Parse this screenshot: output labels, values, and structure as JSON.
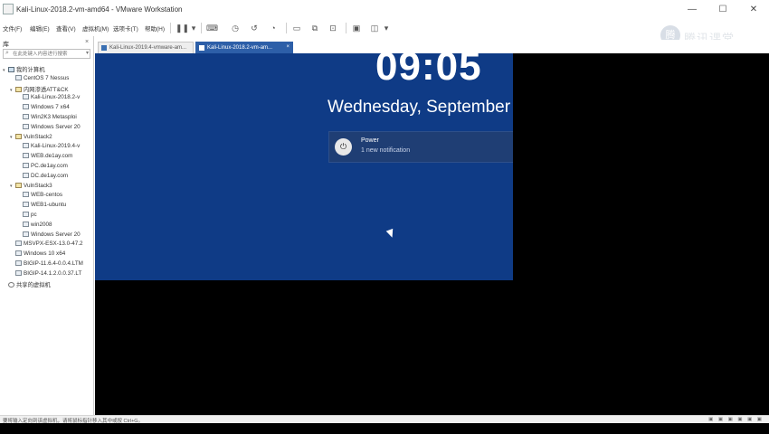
{
  "window": {
    "title": "Kali-Linux-2018.2-vm-amd64 - VMware Workstation",
    "minimize_glyph": "—",
    "maximize_glyph": "☐",
    "close_glyph": "✕"
  },
  "menu": {
    "items": [
      "文件(F)",
      "编辑(E)",
      "查看(V)",
      "虚拟机(M)",
      "选项卡(T)",
      "帮助(H)"
    ]
  },
  "toolbar": {
    "icons": [
      "pause-icon",
      "send-keys-icon",
      "snapshot-icon",
      "revert-snapshot-icon",
      "snapshot-manager-icon",
      "full-screen-icon",
      "unity-icon",
      "console-icon",
      "stretch-icon"
    ]
  },
  "watermark": {
    "badge": "腾",
    "text": "腾讯课堂"
  },
  "library": {
    "title": "库",
    "close_glyph": "×",
    "search_placeholder": "在此处键入内容进行搜索",
    "items": [
      {
        "label": "我的计算机",
        "level": 0,
        "type": "pc"
      },
      {
        "label": "CentOS 7 Nessus",
        "level": 1,
        "type": "vm"
      },
      {
        "label": "内网渗透ATT&CK",
        "level": 1,
        "type": "folder"
      },
      {
        "label": "Kali-Linux-2018.2-v",
        "level": 2,
        "type": "vm"
      },
      {
        "label": "Windows 7 x64",
        "level": 2,
        "type": "vm"
      },
      {
        "label": "Win2K3 Metasploi",
        "level": 2,
        "type": "vm"
      },
      {
        "label": "Windows Server 20",
        "level": 2,
        "type": "vm"
      },
      {
        "label": "VulnStack2",
        "level": 1,
        "type": "folder"
      },
      {
        "label": "Kali-Linux-2019.4-v",
        "level": 2,
        "type": "vm"
      },
      {
        "label": "WEB.de1ay.com",
        "level": 2,
        "type": "vm"
      },
      {
        "label": "PC.de1ay.com",
        "level": 2,
        "type": "vm"
      },
      {
        "label": "DC.de1ay.com",
        "level": 2,
        "type": "vm"
      },
      {
        "label": "VulnStack3",
        "level": 1,
        "type": "folder"
      },
      {
        "label": "WEB-centos",
        "level": 2,
        "type": "vm"
      },
      {
        "label": "WEB1-ubuntu",
        "level": 2,
        "type": "vm"
      },
      {
        "label": "pc",
        "level": 2,
        "type": "vm"
      },
      {
        "label": "win2008",
        "level": 2,
        "type": "vm"
      },
      {
        "label": "Windows Server 20",
        "level": 2,
        "type": "vm"
      },
      {
        "label": "MSVPX-ESX-13.0-47.2",
        "level": 1,
        "type": "vm"
      },
      {
        "label": "Windows 10 x64",
        "level": 1,
        "type": "vm"
      },
      {
        "label": "BIGIP-11.6.4-0.0.4.LTM",
        "level": 1,
        "type": "vm"
      },
      {
        "label": "BIGIP-14.1.2.0.0.37.LT",
        "level": 1,
        "type": "vm"
      },
      {
        "label": "共享的虚拟机",
        "level": 0,
        "type": "share"
      }
    ]
  },
  "tabs": [
    {
      "label": "Kali-Linux-2019.4-vmware-am...",
      "active": false
    },
    {
      "label": "Kali-Linux-2018.2-vm-am...",
      "active": true
    }
  ],
  "vm_screen": {
    "time": "09:05",
    "date": "Wednesday, September",
    "notification": {
      "icon_glyph": "⏻",
      "title": "Power",
      "body": "1 new notification"
    }
  },
  "status": {
    "text": "要将输入定向到该虚拟机，请将鼠标指针移入其中或按 Ctrl+G。",
    "icons": "▣ ▣ ▣ ▣ ▣ ▣"
  },
  "colors": {
    "vm_background": "#0f3b86",
    "active_tab": "#2d5fa8",
    "vm_area": "#000000"
  }
}
